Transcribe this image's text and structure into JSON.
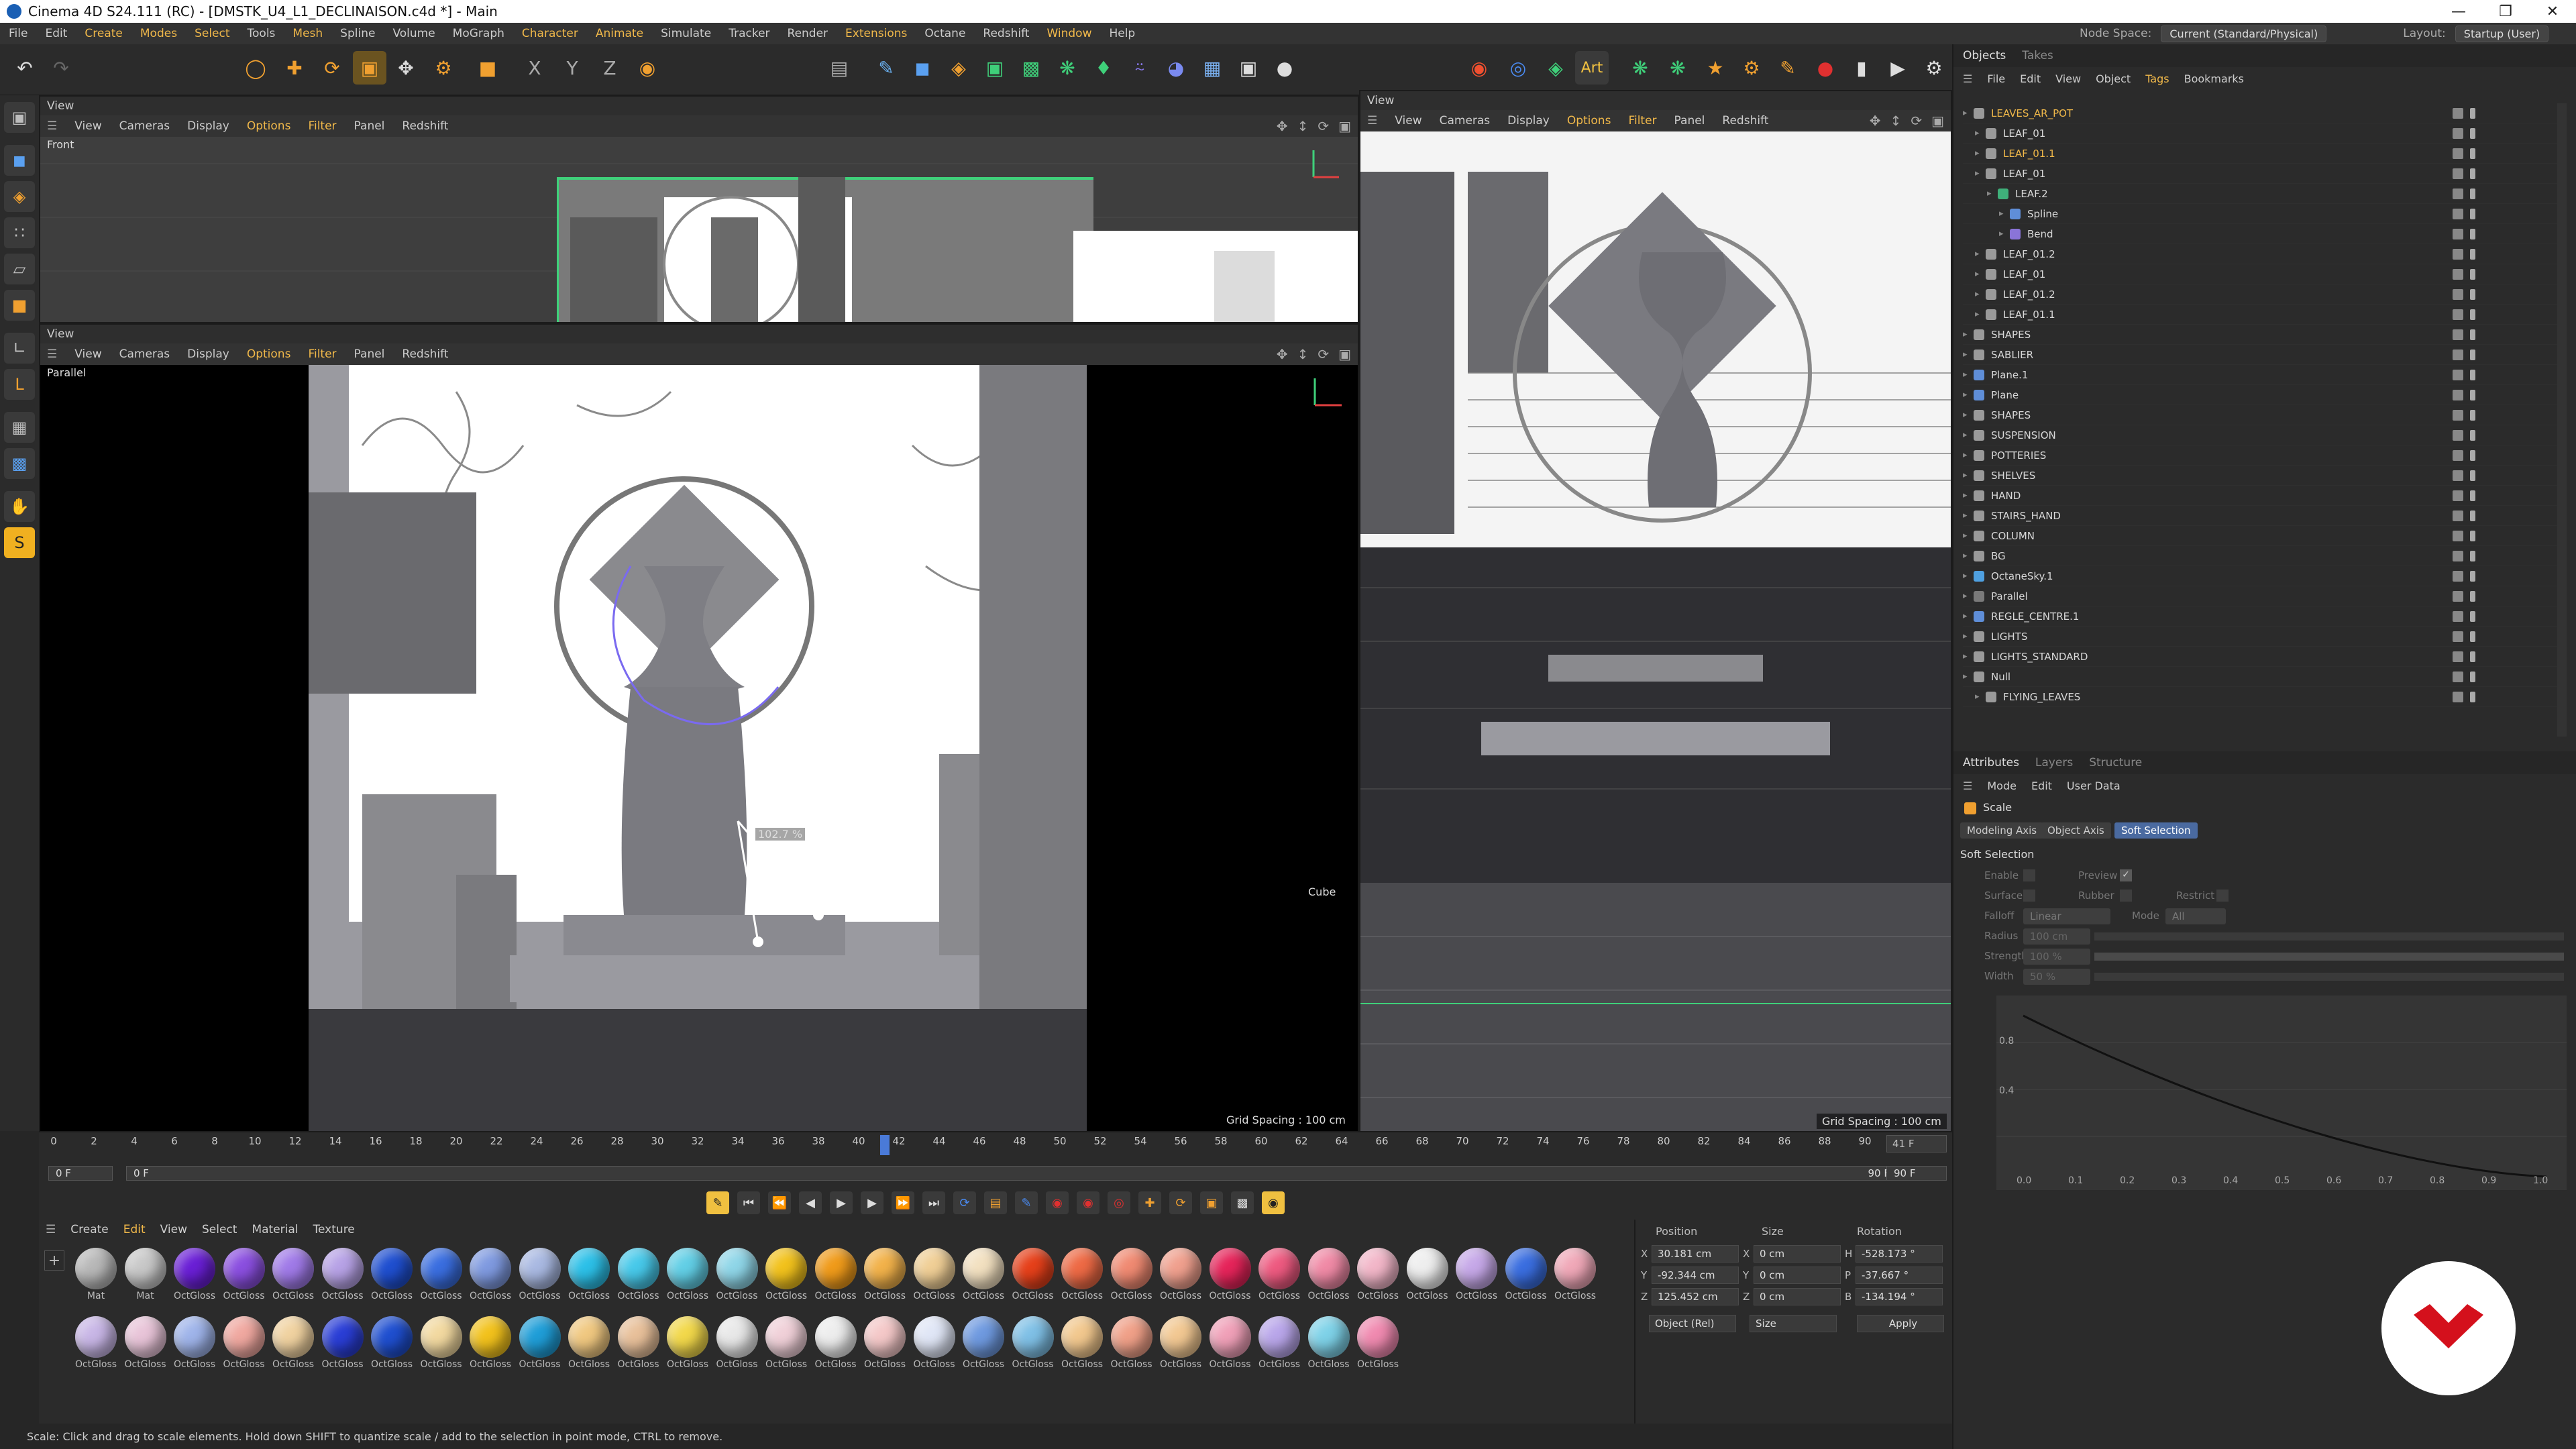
{
  "window": {
    "title": "Cinema 4D S24.111 (RC) - [DMSTK_U4_L1_DECLINAISON.c4d *] - Main"
  },
  "menu": [
    "File",
    "Edit",
    "Create",
    "Modes",
    "Select",
    "Tools",
    "Mesh",
    "Spline",
    "Volume",
    "MoGraph",
    "Character",
    "Animate",
    "Simulate",
    "Tracker",
    "Render",
    "Extensions",
    "Octane",
    "Redshift",
    "Window",
    "Help"
  ],
  "menu_highlight": [
    "Create",
    "Modes",
    "Select",
    "Mesh",
    "Character",
    "Animate",
    "Extensions",
    "Window"
  ],
  "nodespace": {
    "label": "Node Space:",
    "value": "Current (Standard/Physical)",
    "layout_label": "Layout:",
    "layout_value": "Startup (User)"
  },
  "viewports": {
    "top": {
      "title": "View",
      "label": "Front",
      "menu": [
        "View",
        "Cameras",
        "Display",
        "Options",
        "Filter",
        "Panel",
        "Redshift"
      ]
    },
    "main": {
      "title": "View",
      "label": "Parallel",
      "menu": [
        "View",
        "Cameras",
        "Display",
        "Options",
        "Filter",
        "Panel",
        "Redshift"
      ],
      "grid": "Grid Spacing : 100 cm",
      "scale_readout": "102.7 %",
      "cube_label": "Cube"
    },
    "right": {
      "title": "View",
      "menu": [
        "View",
        "Cameras",
        "Display",
        "Options",
        "Filter",
        "Panel",
        "Redshift"
      ],
      "grid": "Grid Spacing : 100 cm"
    }
  },
  "timeline": {
    "ticks": [
      "0",
      "2",
      "4",
      "6",
      "8",
      "10",
      "12",
      "14",
      "16",
      "18",
      "20",
      "22",
      "24",
      "26",
      "28",
      "30",
      "32",
      "34",
      "36",
      "38",
      "40",
      "42",
      "44",
      "46",
      "48",
      "50",
      "52",
      "54",
      "56",
      "58",
      "60",
      "62",
      "64",
      "66",
      "68",
      "70",
      "72",
      "74",
      "76",
      "78",
      "80",
      "82",
      "84",
      "86",
      "88",
      "90"
    ],
    "current": "41 F",
    "start": "0 F",
    "start2": "0 F",
    "end": "90 F",
    "end2": "90 F",
    "cursor_label": "41"
  },
  "materials": {
    "menu": [
      "Create",
      "Edit",
      "View",
      "Select",
      "Material",
      "Texture"
    ],
    "row1": [
      {
        "name": "Mat",
        "color": "#b8b8b8"
      },
      {
        "name": "Mat",
        "color": "#c8c8c8"
      },
      {
        "name": "OctGloss",
        "color": "#6a1fd6"
      },
      {
        "name": "OctGloss",
        "color": "#8b4fe0"
      },
      {
        "name": "OctGloss",
        "color": "#a07ae8"
      },
      {
        "name": "OctGloss",
        "color": "#b7a2e6"
      },
      {
        "name": "OctGloss",
        "color": "#1f4fd0"
      },
      {
        "name": "OctGloss",
        "color": "#3a6ee0"
      },
      {
        "name": "OctGloss",
        "color": "#7f9ae0"
      },
      {
        "name": "OctGloss",
        "color": "#a9b9e2"
      },
      {
        "name": "OctGloss",
        "color": "#2cc0e8"
      },
      {
        "name": "OctGloss",
        "color": "#47c9ea"
      },
      {
        "name": "OctGloss",
        "color": "#62cfe6"
      },
      {
        "name": "OctGloss",
        "color": "#8fd6e8"
      },
      {
        "name": "OctGloss",
        "color": "#f2c21c"
      },
      {
        "name": "OctGloss",
        "color": "#f09b1a"
      },
      {
        "name": "OctGloss",
        "color": "#f2b24a"
      },
      {
        "name": "OctGloss",
        "color": "#f0cf96"
      },
      {
        "name": "OctGloss",
        "color": "#f2e0c0"
      },
      {
        "name": "OctGloss",
        "color": "#e6401a"
      },
      {
        "name": "OctGloss",
        "color": "#ee6a45"
      },
      {
        "name": "OctGloss",
        "color": "#f08a72"
      },
      {
        "name": "OctGloss",
        "color": "#f0a08e"
      },
      {
        "name": "OctGloss",
        "color": "#e6245a"
      },
      {
        "name": "OctGloss",
        "color": "#ee5a80"
      },
      {
        "name": "OctGloss",
        "color": "#f08aa6"
      },
      {
        "name": "OctGloss",
        "color": "#f2b6c8"
      },
      {
        "name": "OctGloss",
        "color": "#eeeeee"
      },
      {
        "name": "OctGloss",
        "color": "#c6a8e8"
      },
      {
        "name": "OctGloss",
        "color": "#3a6ee0"
      },
      {
        "name": "OctGloss",
        "color": "#f0a8b8"
      }
    ],
    "row2": [
      {
        "name": "OctGloss",
        "color": "#c8b6e6"
      },
      {
        "name": "OctGloss",
        "color": "#e8c4d8"
      },
      {
        "name": "OctGloss",
        "color": "#9fb4ea"
      },
      {
        "name": "OctGloss",
        "color": "#f0a8a0"
      },
      {
        "name": "OctGloss",
        "color": "#f0d2a0"
      },
      {
        "name": "OctGloss",
        "color": "#2a3ed6"
      },
      {
        "name": "OctGloss",
        "color": "#1f4fd0"
      },
      {
        "name": "OctGloss",
        "color": "#f2d9a0"
      },
      {
        "name": "OctGloss",
        "color": "#f2c21c"
      },
      {
        "name": "OctGloss",
        "color": "#1f9ed8"
      },
      {
        "name": "OctGloss",
        "color": "#f0c880"
      },
      {
        "name": "OctGloss",
        "color": "#e8c09a"
      },
      {
        "name": "OctGloss",
        "color": "#f2d84a"
      },
      {
        "name": "OctGloss",
        "color": "#e8e8e8"
      },
      {
        "name": "OctGloss",
        "color": "#f0d0d8"
      },
      {
        "name": "OctGloss",
        "color": "#ededed"
      },
      {
        "name": "OctGloss",
        "color": "#f4c8c8"
      },
      {
        "name": "OctGloss",
        "color": "#e0e6f6"
      },
      {
        "name": "OctGloss",
        "color": "#6f9ae0"
      },
      {
        "name": "OctGloss",
        "color": "#7fc0e6"
      },
      {
        "name": "OctGloss",
        "color": "#f2c88e"
      },
      {
        "name": "OctGloss",
        "color": "#f0a088"
      },
      {
        "name": "OctGloss",
        "color": "#f2c892"
      },
      {
        "name": "OctGloss",
        "color": "#f0a0b8"
      },
      {
        "name": "OctGloss",
        "color": "#b9a6ea"
      },
      {
        "name": "OctGloss",
        "color": "#7ed2e8"
      },
      {
        "name": "OctGloss",
        "color": "#f08ab0"
      }
    ]
  },
  "coords": {
    "headers": [
      "Position",
      "Size",
      "Rotation"
    ],
    "rows": [
      {
        "axis": "X",
        "pos": "30.181 cm",
        "saxis": "X",
        "size": "0 cm",
        "raxis": "H",
        "rot": "-528.173 °"
      },
      {
        "axis": "Y",
        "pos": "-92.344 cm",
        "saxis": "Y",
        "size": "0 cm",
        "raxis": "P",
        "rot": "-37.667 °"
      },
      {
        "axis": "Z",
        "pos": "125.452 cm",
        "saxis": "Z",
        "size": "0 cm",
        "raxis": "B",
        "rot": "-134.194 °"
      }
    ],
    "mode": "Object (Rel)",
    "size_mode": "Size",
    "apply": "Apply"
  },
  "status": "Scale: Click and drag to scale elements. Hold down SHIFT to quantize scale / add to the selection in point mode, CTRL to remove.",
  "objects": {
    "tabs": [
      "Objects",
      "Takes"
    ],
    "menu": [
      "File",
      "Edit",
      "View",
      "Object",
      "Tags",
      "Bookmarks"
    ],
    "items": [
      {
        "name": "LEAVES_AR_POT",
        "indent": 0,
        "sel": true,
        "icon": "#9a9a9a"
      },
      {
        "name": "LEAF_01",
        "indent": 1,
        "sel": false,
        "icon": "#9a9a9a"
      },
      {
        "name": "LEAF_01.1",
        "indent": 1,
        "sel": true,
        "icon": "#9a9a9a"
      },
      {
        "name": "LEAF_01",
        "indent": 1,
        "sel": false,
        "icon": "#9a9a9a"
      },
      {
        "name": "LEAF.2",
        "indent": 2,
        "sel": false,
        "icon": "#3fb07a"
      },
      {
        "name": "Spline",
        "indent": 3,
        "sel": false,
        "icon": "#5f8ed8"
      },
      {
        "name": "Bend",
        "indent": 3,
        "sel": false,
        "icon": "#8a74d8"
      },
      {
        "name": "LEAF_01.2",
        "indent": 1,
        "sel": false,
        "icon": "#9a9a9a"
      },
      {
        "name": "LEAF_01",
        "indent": 1,
        "sel": false,
        "icon": "#9a9a9a"
      },
      {
        "name": "LEAF_01.2",
        "indent": 1,
        "sel": false,
        "icon": "#9a9a9a"
      },
      {
        "name": "LEAF_01.1",
        "indent": 1,
        "sel": false,
        "icon": "#9a9a9a"
      },
      {
        "name": "SHAPES",
        "indent": 0,
        "sel": false,
        "icon": "#9a9a9a"
      },
      {
        "name": "SABLIER",
        "indent": 0,
        "sel": false,
        "icon": "#9a9a9a"
      },
      {
        "name": "Plane.1",
        "indent": 0,
        "sel": false,
        "icon": "#5f8ed8"
      },
      {
        "name": "Plane",
        "indent": 0,
        "sel": false,
        "icon": "#5f8ed8"
      },
      {
        "name": "SHAPES",
        "indent": 0,
        "sel": false,
        "icon": "#9a9a9a"
      },
      {
        "name": "SUSPENSION",
        "indent": 0,
        "sel": false,
        "icon": "#9a9a9a"
      },
      {
        "name": "POTTERIES",
        "indent": 0,
        "sel": false,
        "icon": "#9a9a9a"
      },
      {
        "name": "SHELVES",
        "indent": 0,
        "sel": false,
        "icon": "#9a9a9a"
      },
      {
        "name": "HAND",
        "indent": 0,
        "sel": false,
        "icon": "#9a9a9a"
      },
      {
        "name": "STAIRS_HAND",
        "indent": 0,
        "sel": false,
        "icon": "#9a9a9a"
      },
      {
        "name": "COLUMN",
        "indent": 0,
        "sel": false,
        "icon": "#9a9a9a"
      },
      {
        "name": "BG",
        "indent": 0,
        "sel": false,
        "icon": "#9a9a9a"
      },
      {
        "name": "OctaneSky.1",
        "indent": 0,
        "sel": false,
        "icon": "#4fa0e0"
      },
      {
        "name": "Parallel",
        "indent": 0,
        "sel": false,
        "icon": "#7a7a7a"
      },
      {
        "name": "REGLE_CENTRE.1",
        "indent": 0,
        "sel": false,
        "icon": "#5f8ed8"
      },
      {
        "name": "LIGHTS",
        "indent": 0,
        "sel": false,
        "icon": "#9a9a9a"
      },
      {
        "name": "LIGHTS_STANDARD",
        "indent": 0,
        "sel": false,
        "icon": "#9a9a9a"
      },
      {
        "name": "Null",
        "indent": 0,
        "sel": false,
        "icon": "#9a9a9a"
      },
      {
        "name": "FLYING_LEAVES",
        "indent": 1,
        "sel": false,
        "icon": "#9a9a9a"
      }
    ]
  },
  "attributes": {
    "tabs": [
      "Attributes",
      "Layers",
      "Structure"
    ],
    "menu": [
      "Mode",
      "Edit",
      "User Data"
    ],
    "tool": "Scale",
    "subtabs": [
      "Modeling Axis",
      "Object Axis",
      "Soft Selection"
    ],
    "section": "Soft Selection",
    "enable": "Enable",
    "preview": "Preview",
    "surface": "Surface",
    "rubber": "Rubber",
    "restrict": "Restrict",
    "falloff": "Falloff",
    "falloff_val": "Linear",
    "mode": "Mode",
    "mode_val": "All",
    "radius": "Radius",
    "radius_val": "100 cm",
    "strength": "Strength",
    "strength_val": "100 %",
    "width": "Width",
    "width_val": "50 %",
    "graph_y": [
      "0.8",
      "0.4"
    ],
    "graph_x": [
      "0.0",
      "0.1",
      "0.2",
      "0.3",
      "0.4",
      "0.5",
      "0.6",
      "0.7",
      "0.8",
      "0.9",
      "1.0"
    ]
  }
}
